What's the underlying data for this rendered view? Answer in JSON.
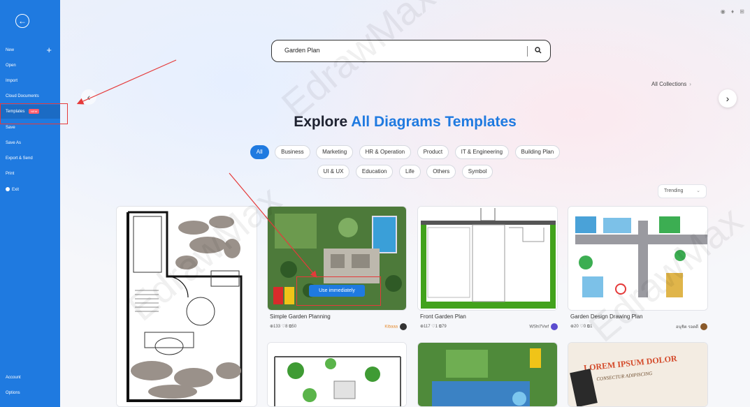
{
  "sidebar": {
    "items": [
      {
        "label": "New"
      },
      {
        "label": "Open"
      },
      {
        "label": "Import"
      },
      {
        "label": "Cloud Documents"
      },
      {
        "label": "Templates",
        "badge": "NEW"
      },
      {
        "label": "Save"
      },
      {
        "label": "Save As"
      },
      {
        "label": "Export & Send"
      },
      {
        "label": "Print"
      },
      {
        "label": "Exit"
      }
    ],
    "bottom": [
      {
        "label": "Account"
      },
      {
        "label": "Options"
      }
    ],
    "back_icon": "back-arrow-icon"
  },
  "search": {
    "value": "Garden Plan"
  },
  "all_collections": "All Collections",
  "headline": {
    "part1": "Explore",
    "part2": "All Diagrams Templates"
  },
  "categories_row1": [
    "All",
    "Business",
    "Marketing",
    "HR & Operation",
    "Product",
    "IT & Engineering",
    "Building Plan"
  ],
  "categories_row2": [
    "UI & UX",
    "Education",
    "Life",
    "Others",
    "Symbol"
  ],
  "sort": "Trending",
  "cards": [
    {
      "title": "Simple Garden Planning",
      "views": "133",
      "likes": "8",
      "copies": "50",
      "author": "Kibaaa"
    },
    {
      "title": "Front Garden Plan",
      "views": "117",
      "likes": "1",
      "copies": "79",
      "author": "WShi7Vwf"
    },
    {
      "title": "Garden Design Drawing Plan",
      "views": "20",
      "likes": "0",
      "copies": "1",
      "author": "อนุชิต รอดดี"
    }
  ],
  "use_button": "Use immediately",
  "watermark": "EdrawMax",
  "colors": {
    "accent": "#1f7ae0",
    "highlight": "#e53a3a"
  }
}
